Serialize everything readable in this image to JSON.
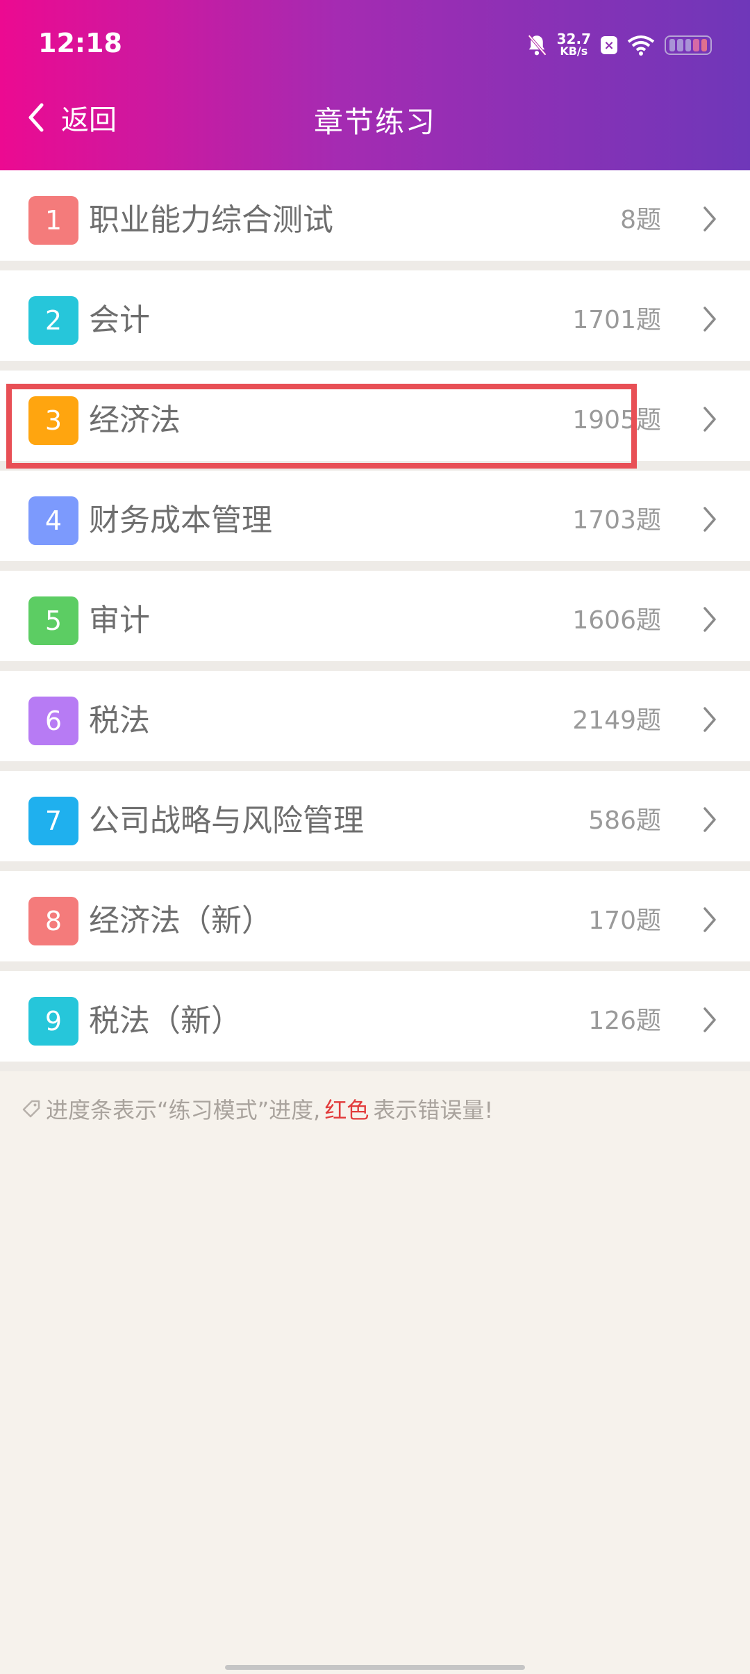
{
  "status_bar": {
    "time": "12:18",
    "speed_value": "32.7",
    "speed_unit": "KB/s",
    "net_badge": "×"
  },
  "nav": {
    "back_label": "返回",
    "title": "章节练习"
  },
  "chapters": [
    {
      "index": "1",
      "name": "职业能力综合测试",
      "count": "8题",
      "color": "#f47b7b"
    },
    {
      "index": "2",
      "name": "会计",
      "count": "1701题",
      "color": "#26c6da"
    },
    {
      "index": "3",
      "name": "经济法",
      "count": "1905题",
      "color": "#ffa50f"
    },
    {
      "index": "4",
      "name": "财务成本管理",
      "count": "1703题",
      "color": "#7c9afd"
    },
    {
      "index": "5",
      "name": "审计",
      "count": "1606题",
      "color": "#5ccd63"
    },
    {
      "index": "6",
      "name": "税法",
      "count": "2149题",
      "color": "#b77bf4"
    },
    {
      "index": "7",
      "name": "公司战略与风险管理",
      "count": "586题",
      "color": "#1fb0ee"
    },
    {
      "index": "8",
      "name": "经济法（新）",
      "count": "170题",
      "color": "#f47b7b"
    },
    {
      "index": "9",
      "name": "税法（新）",
      "count": "126题",
      "color": "#26c6da"
    }
  ],
  "hint": {
    "prefix": "进度条表示“练习模式”进度,",
    "red_word": "红色",
    "suffix": "表示错误量!"
  },
  "colors": {
    "highlight": "#e84f55",
    "header_start": "#ec0a91",
    "header_end": "#6f37b9"
  }
}
